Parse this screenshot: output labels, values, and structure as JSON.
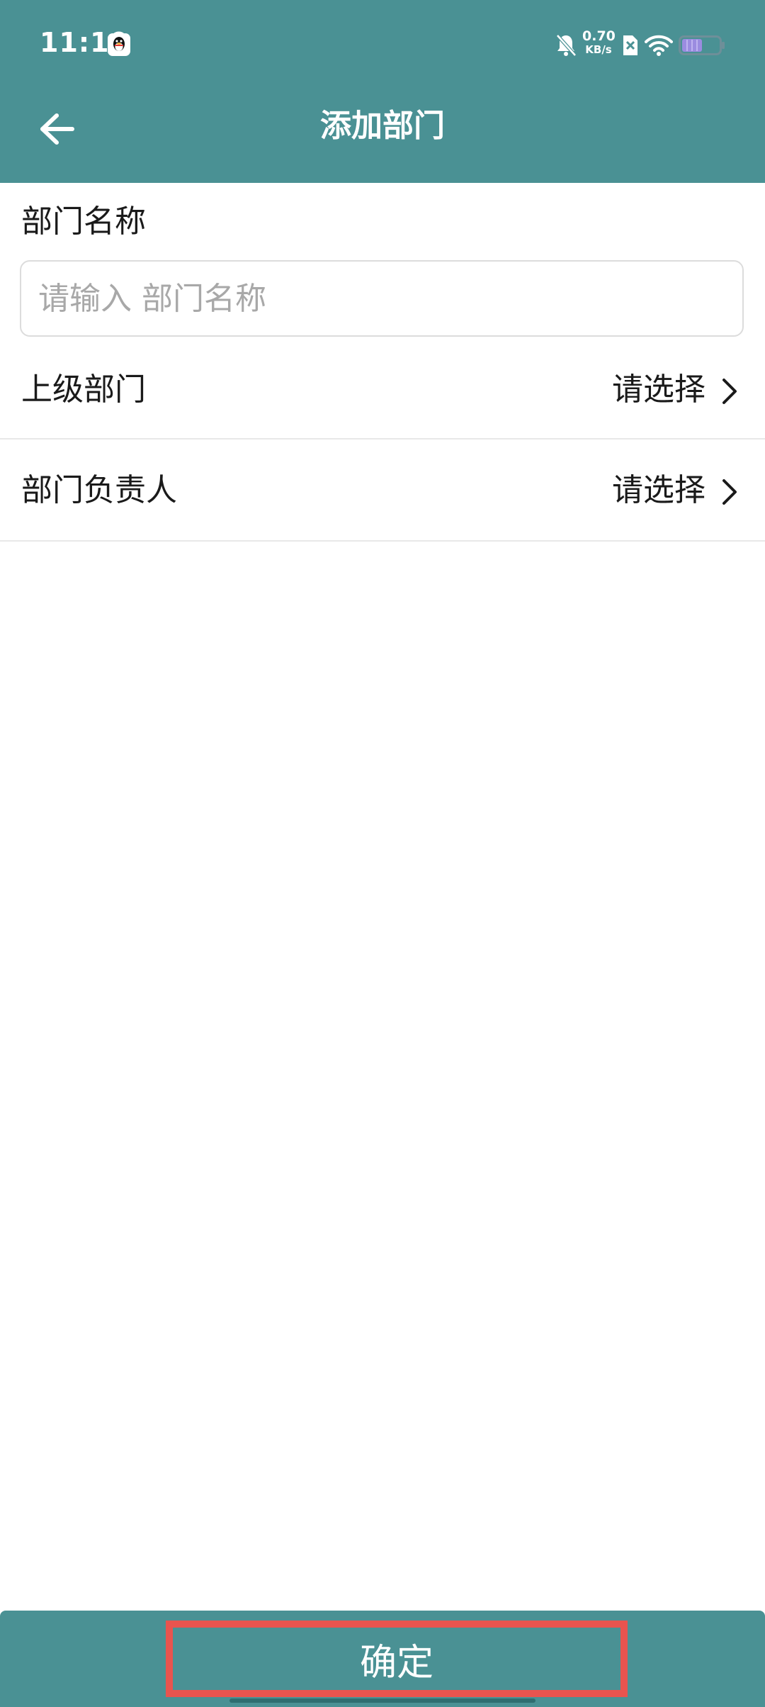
{
  "status_bar": {
    "time": "11:10",
    "net_speed_value": "0.70",
    "net_speed_unit": "KB/s",
    "battery_level": 0.55
  },
  "app_bar": {
    "title": "添加部门"
  },
  "form": {
    "name_label": "部门名称",
    "name_placeholder": "请输入 部门名称",
    "name_value": "",
    "parent_row": {
      "label": "上级部门",
      "value": "请选择"
    },
    "leader_row": {
      "label": "部门负责人",
      "value": "请选择"
    }
  },
  "footer": {
    "confirm_label": "确定"
  },
  "colors": {
    "primary": "#4a9194",
    "highlight_border": "#e8544f"
  },
  "icons": {
    "back": "arrow-left-icon",
    "chevron": "chevron-right-icon",
    "mute": "bell-off-icon",
    "wifi": "wifi-icon",
    "battery": "battery-icon",
    "qq": "qq-icon",
    "sim": "sim-icon"
  }
}
